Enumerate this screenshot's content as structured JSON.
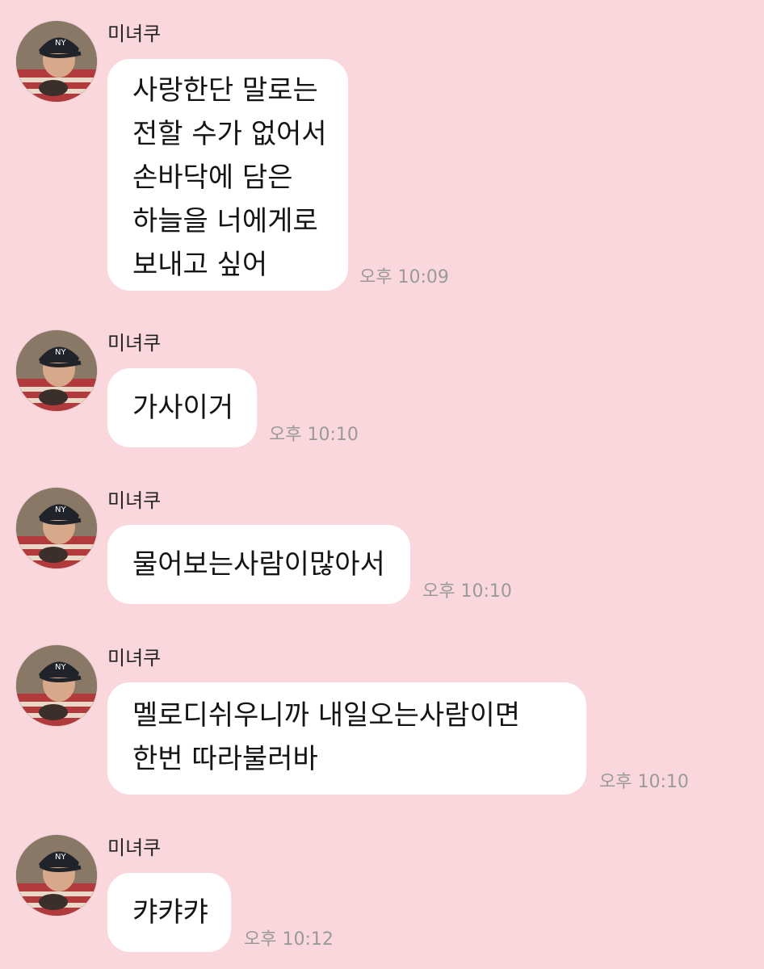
{
  "messages": [
    {
      "sender": "미녀쿠",
      "lines": [
        "사랑한단 말로는",
        "전할 수가 없어서",
        "손바닥에 담은",
        "하늘을 너에게로",
        "보내고 싶어"
      ],
      "time": "오후 10:09"
    },
    {
      "sender": "미녀쿠",
      "lines": [
        "가사이거"
      ],
      "time": "오후 10:10"
    },
    {
      "sender": "미녀쿠",
      "lines": [
        "물어보는사람이많아서"
      ],
      "time": "오후 10:10"
    },
    {
      "sender": "미녀쿠",
      "lines": [
        "멜로디쉬우니까 내일오는사람이면",
        "한번 따라불러바"
      ],
      "time": "오후 10:10"
    },
    {
      "sender": "미녀쿠",
      "lines": [
        "캬캬캬"
      ],
      "time": "오후 10:12"
    }
  ],
  "avatar": {
    "icon": "profile-photo-avatar",
    "cap_color": "#20242a",
    "shirt_color": "#b33a3c"
  },
  "colors": {
    "background": "#f9d7dd",
    "bubble": "#ffffff",
    "timestamp": "#9a9a9a"
  }
}
